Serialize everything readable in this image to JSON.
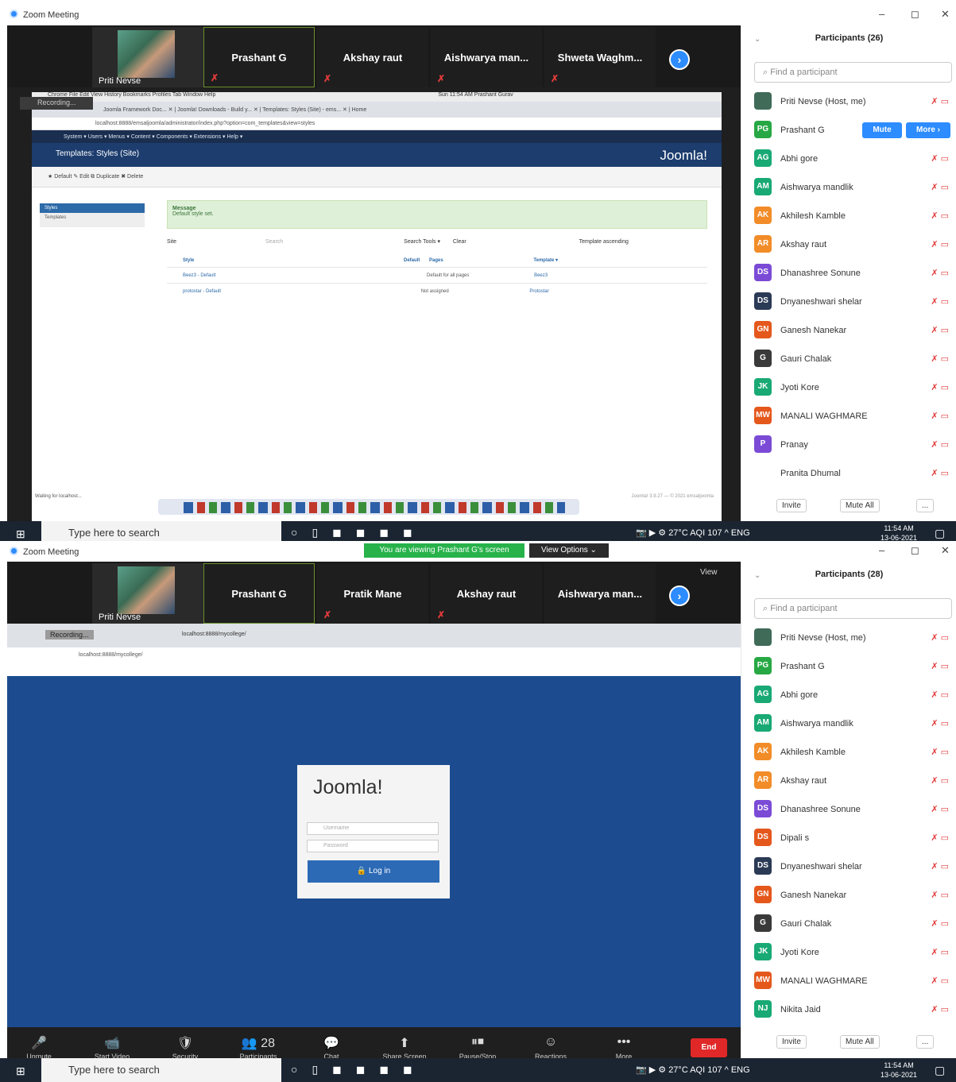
{
  "window": {
    "title": "Zoom Meeting",
    "minimize": "–",
    "restore": "◻",
    "close": "✕"
  },
  "top": {
    "tiles": {
      "host": "Priti Nevse",
      "t1": "Prashant G",
      "t2": "Akshay raut",
      "t3": "Aishwarya man...",
      "t4": "Shweta Waghm..."
    },
    "shared": {
      "mac_menu": "Chrome  File  Edit  View  History  Bookmarks  Profiles  Tab  Window  Help",
      "mac_status": "Sun 11:54 AM    Prashant Gurav",
      "tabs": "Joomla Framework Doc...   ✕  |  Joomla! Downloads - Build y...  ✕  |  Templates: Styles (Site) - ems...  ✕  |  Home",
      "url": "localhost:8888/emsaljoomla/administrator/index.php?option=com_templates&view=styles",
      "jnav": "System ▾   Users ▾   Menus ▾   Content ▾   Components ▾   Extensions ▾   Help ▾",
      "page_title": "Templates: Styles (Site)",
      "logo": "Joomla!",
      "toolbar": "★ Default    ✎ Edit    ⧉ Duplicate    ✖ Delete",
      "side_styles": "Styles",
      "side_templates": "Templates",
      "msg_title": "Message",
      "msg_text": "Default style set.",
      "filter": "Site",
      "search": "Search",
      "search_tools": "Search Tools ▾",
      "clear": "Clear",
      "sort": "Template ascending",
      "col_style": "Style",
      "col_default": "Default",
      "col_pages": "Pages",
      "col_template": "Template ▾",
      "row1_style": "Beez3 - Default",
      "row1_pages": "Default for all pages",
      "row1_template": "Beez3",
      "row2_style": "protostar - Default",
      "row2_pages": "Not assigned",
      "row2_template": "Protostar",
      "status": "Waiting for localhost...",
      "footer_right": "Joomla! 3.9.27 — © 2021 emsaljoomla",
      "recording": "Recording..."
    },
    "participants": {
      "title": "Participants (26)",
      "search_placeholder": "Find a participant",
      "list": [
        {
          "i": "",
          "n": "Priti Nevse (Host, me)",
          "c": "#3f6b58"
        },
        {
          "i": "PG",
          "n": "Prashant G",
          "c": "#27a844"
        },
        {
          "i": "AG",
          "n": "Abhi gore",
          "c": "#19a974"
        },
        {
          "i": "AM",
          "n": "Aishwarya mandlik",
          "c": "#19a974"
        },
        {
          "i": "AK",
          "n": "Akhilesh Kamble",
          "c": "#f28c28"
        },
        {
          "i": "AR",
          "n": "Akshay raut",
          "c": "#f28c28"
        },
        {
          "i": "DS",
          "n": "Dhanashree Sonune",
          "c": "#7b4bd6"
        },
        {
          "i": "DS",
          "n": "Dnyaneshwari shelar",
          "c": "#2b3a55"
        },
        {
          "i": "GN",
          "n": "Ganesh Nanekar",
          "c": "#e4581c"
        },
        {
          "i": "G",
          "n": "Gauri Chalak",
          "c": "#3a3a3a"
        },
        {
          "i": "JK",
          "n": "Jyoti Kore",
          "c": "#19a974"
        },
        {
          "i": "MW",
          "n": "MANALI WAGHMARE",
          "c": "#e4581c"
        },
        {
          "i": "P",
          "n": "Pranay",
          "c": "#7b4bd6"
        },
        {
          "i": "",
          "n": "Pranita Dhumal",
          "c": "#ffffff"
        }
      ],
      "mute": "Mute",
      "more": "More ›",
      "invite": "Invite",
      "mute_all": "Mute All",
      "dots": "..."
    },
    "taskbar": {
      "search": "Type here to search",
      "tray": "27°C  AQI 107   ^   ENG",
      "time": "11:54 AM",
      "date": "13-06-2021"
    }
  },
  "bottom": {
    "banner": "You are viewing Prashant G's screen",
    "view_options": "View Options ⌄",
    "view": "View",
    "tiles": {
      "host": "Priti Nevse",
      "t1": "Prashant G",
      "t2": "Pratik Mane",
      "t3": "Akshay raut",
      "t4": "Aishwarya man..."
    },
    "shared": {
      "tab": "localhost:8888/mycollege/",
      "recording": "Recording...",
      "url": "localhost:8888/mycollege/",
      "logo": "Joomla!",
      "username": "Username",
      "password": "Password",
      "login": "Log in"
    },
    "zoom_controls": [
      {
        "icon": "🎤",
        "label": "Unmute"
      },
      {
        "icon": "📹",
        "label": "Start Video"
      },
      {
        "icon": "🛡",
        "label": "Security"
      },
      {
        "icon": "👥 28",
        "label": "Participants"
      },
      {
        "icon": "💬",
        "label": "Chat"
      },
      {
        "icon": "⬆",
        "label": "Share Screen"
      },
      {
        "icon": "⏸⏹",
        "label": "Pause/Stop Recording"
      },
      {
        "icon": "☺",
        "label": "Reactions"
      },
      {
        "icon": "•••",
        "label": "More"
      }
    ],
    "end": "End",
    "participants": {
      "title": "Participants (28)",
      "search_placeholder": "Find a participant",
      "list": [
        {
          "i": "",
          "n": "Priti Nevse (Host, me)",
          "c": "#3f6b58"
        },
        {
          "i": "PG",
          "n": "Prashant G",
          "c": "#27a844"
        },
        {
          "i": "AG",
          "n": "Abhi gore",
          "c": "#19a974"
        },
        {
          "i": "AM",
          "n": "Aishwarya mandlik",
          "c": "#19a974"
        },
        {
          "i": "AK",
          "n": "Akhilesh Kamble",
          "c": "#f28c28"
        },
        {
          "i": "AR",
          "n": "Akshay raut",
          "c": "#f28c28"
        },
        {
          "i": "DS",
          "n": "Dhanashree Sonune",
          "c": "#7b4bd6"
        },
        {
          "i": "DS",
          "n": "Dipali s",
          "c": "#e4581c"
        },
        {
          "i": "DS",
          "n": "Dnyaneshwari shelar",
          "c": "#2b3a55"
        },
        {
          "i": "GN",
          "n": "Ganesh Nanekar",
          "c": "#e4581c"
        },
        {
          "i": "G",
          "n": "Gauri Chalak",
          "c": "#3a3a3a"
        },
        {
          "i": "JK",
          "n": "Jyoti Kore",
          "c": "#19a974"
        },
        {
          "i": "MW",
          "n": "MANALI WAGHMARE",
          "c": "#e4581c"
        },
        {
          "i": "NJ",
          "n": "Nikita Jaid",
          "c": "#19a974"
        }
      ],
      "invite": "Invite",
      "mute_all": "Mute All",
      "dots": "..."
    },
    "taskbar": {
      "search": "Type here to search",
      "tray": "27°C  AQI 107   ^   ENG",
      "time": "11:54 AM",
      "date": "13-06-2021"
    }
  }
}
